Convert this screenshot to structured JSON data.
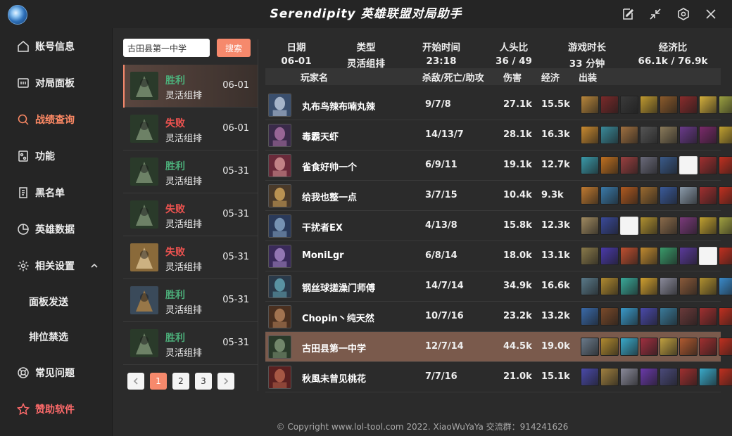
{
  "app": {
    "title": "Serendipity  英雄联盟对局助手"
  },
  "sidebar": {
    "items": [
      {
        "label": "账号信息",
        "icon": "home-icon"
      },
      {
        "label": "对局面板",
        "icon": "panel-icon"
      },
      {
        "label": "战绩查询",
        "icon": "search-icon",
        "active": true
      },
      {
        "label": "功能",
        "icon": "toolbox-icon"
      },
      {
        "label": "黑名单",
        "icon": "document-icon"
      },
      {
        "label": "英雄数据",
        "icon": "pie-chart-icon"
      },
      {
        "label": "相关设置",
        "icon": "gear-icon"
      },
      {
        "label": "面板发送"
      },
      {
        "label": "排位禁选"
      },
      {
        "label": "常见问题",
        "icon": "lifebuoy-icon"
      },
      {
        "label": "赞助软件",
        "icon": "star-icon"
      }
    ]
  },
  "search": {
    "value": "古田县第一中学",
    "button_label": "搜索"
  },
  "matches": [
    {
      "result": "胜利",
      "mode": "灵活组排",
      "date": "06-01",
      "win": true,
      "selected": true
    },
    {
      "result": "失败",
      "mode": "灵活组排",
      "date": "06-01",
      "win": false
    },
    {
      "result": "胜利",
      "mode": "灵活组排",
      "date": "05-31",
      "win": true
    },
    {
      "result": "失败",
      "mode": "灵活组排",
      "date": "05-31",
      "win": false
    },
    {
      "result": "失败",
      "mode": "灵活组排",
      "date": "05-31",
      "win": false
    },
    {
      "result": "胜利",
      "mode": "灵活组排",
      "date": "05-31",
      "win": true
    },
    {
      "result": "胜利",
      "mode": "灵活组排",
      "date": "05-31",
      "win": true
    }
  ],
  "pagination": {
    "pages": [
      "1",
      "2",
      "3"
    ],
    "current": "1"
  },
  "summary": {
    "date_label": "日期",
    "date": "06-01",
    "type_label": "类型",
    "type": "灵活组排",
    "start_label": "开始时间",
    "start": "23:18",
    "kills_label": "人头比",
    "kills": "36 / 49",
    "duration_label": "游戏时长",
    "duration": "33 分钟",
    "economy_label": "经济比",
    "economy": "66.1k / 76.9k"
  },
  "table": {
    "headers": {
      "player": "玩家名",
      "kda": "杀敌/死亡/助攻",
      "damage": "伤害",
      "gold": "经济",
      "items": "出装"
    },
    "rows": [
      {
        "name": "丸布鸟辣布喃丸辣",
        "kda": "9/7/8",
        "damage": "27.1k",
        "gold": "15.5k",
        "colors": [
          "#3a4f6e",
          "#c9d6e8"
        ],
        "items": [
          "#b8863b",
          "#7a2a2a",
          "#3a3a3a",
          "#c09a30",
          "#8b5a2b",
          "#8a2c2c",
          "#d4b03c",
          "#9aa040"
        ]
      },
      {
        "name": "毒霸天虾",
        "kda": "14/13/7",
        "damage": "28.1k",
        "gold": "16.3k",
        "colors": [
          "#3a2a4a",
          "#b77ab0"
        ],
        "items": [
          "#c98a30",
          "#3a8a9a",
          "#a07040",
          "#555555",
          "#8a7a5a",
          "#6a3a8a",
          "#7a2a6a",
          "#c0a030"
        ]
      },
      {
        "name": "雀食好帅一个",
        "kda": "6/9/11",
        "damage": "19.1k",
        "gold": "12.7k",
        "colors": [
          "#6a2a3a",
          "#e0a0a0"
        ],
        "items": [
          "#3a9aaa",
          "#c07020",
          "#9a4040",
          "#6a6a7a",
          "#3a5a8a",
          "",
          "#a03030",
          "#c03020"
        ]
      },
      {
        "name": "给我也整一点",
        "kda": "3/7/15",
        "damage": "10.4k",
        "gold": "9.3k",
        "colors": [
          "#4a3a2a",
          "#e0b060"
        ],
        "items": [
          "#c07a30",
          "#3a7aaa",
          "#b05a20",
          "#9a6a30",
          "#3a5a9a",
          "#8a9aaa",
          "#a03030",
          "#c03020"
        ]
      },
      {
        "name": "干扰者EX",
        "kda": "4/13/8",
        "damage": "15.8k",
        "gold": "12.3k",
        "colors": [
          "#2a3a5a",
          "#90b0d0"
        ],
        "items": [
          "#a08a60",
          "#3a4a9a",
          "",
          "#b09030",
          "#8a6a4a",
          "#7a3a7a",
          "#c0a030",
          "#a0a040"
        ]
      },
      {
        "name": "MoniLgr",
        "kda": "6/8/14",
        "damage": "18.0k",
        "gold": "13.1k",
        "colors": [
          "#3a2a5a",
          "#b090d0"
        ],
        "items": [
          "#8a7a4a",
          "#4a3aaa",
          "#c05030",
          "#c08a30",
          "#3a9a6a",
          "#5a3a9a",
          "",
          "#c03020"
        ]
      },
      {
        "name": "钢丝球搓澡门师傅",
        "kda": "14/7/14",
        "damage": "34.9k",
        "gold": "16.6k",
        "colors": [
          "#2a3a4a",
          "#6ab0c0"
        ],
        "items": [
          "#5a7a8a",
          "#b08a30",
          "#3aaa9a",
          "#d0a030",
          "#8a8a9a",
          "#8a5a3a",
          "#b09030",
          "#3a8aca"
        ]
      },
      {
        "name": "Chopin丶纯天然",
        "kda": "10/7/16",
        "damage": "23.2k",
        "gold": "13.2k",
        "colors": [
          "#4a3020",
          "#c08a60"
        ],
        "items": [
          "#3a6aaa",
          "#7a4a2a",
          "#3a9aca",
          "#4a4aaa",
          "#3a7a9a",
          "#6a3a3a",
          "#a03030",
          "#c03020"
        ]
      },
      {
        "name": "古田县第一中学",
        "kda": "12/7/14",
        "damage": "44.5k",
        "gold": "19.0k",
        "me": true,
        "colors": [
          "#2a3a2a",
          "#8aa080"
        ],
        "items": [
          "#6a7a8a",
          "#b08a30",
          "#3aaaca",
          "#a03040",
          "#c0a040",
          "#b05a30",
          "#a03030",
          "#c03020"
        ]
      },
      {
        "name": "秋風未曾见桃花",
        "kda": "7/7/16",
        "damage": "21.0k",
        "gold": "15.1k",
        "colors": [
          "#5a2020",
          "#c06a50"
        ],
        "items": [
          "#4a4aaa",
          "#a08040",
          "#8a8a9a",
          "#6a3aaa",
          "#4a4a7a",
          "#a03030",
          "#3aaaca",
          "#c03020"
        ]
      }
    ]
  },
  "footer": {
    "text": "© Copyright www.lol-tool.com 2022.   XiaoWuYaYa   交流群：914241626"
  },
  "colors": {
    "accent": "#f6896c",
    "win": "#4caf7a",
    "loss": "#ef5350",
    "my_row": "#7a5a4c"
  }
}
